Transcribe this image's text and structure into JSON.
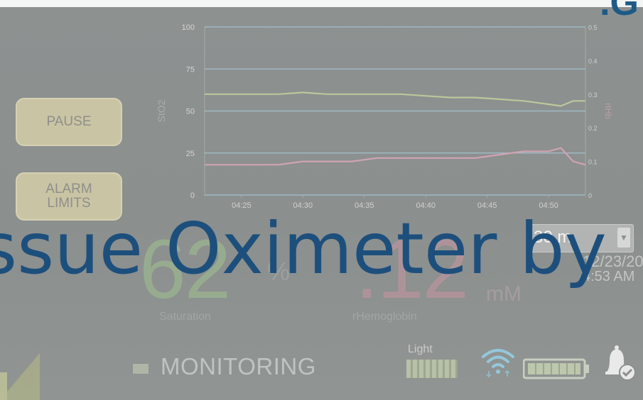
{
  "corner_fragment": ".G",
  "buttons": {
    "pause": "PAUSE",
    "alarm_line1": "ALARM",
    "alarm_line2": "LIMITS"
  },
  "chart_data": {
    "type": "line",
    "x_ticks": [
      "04:25",
      "04:30",
      "04:35",
      "04:40",
      "04:45",
      "04:50"
    ],
    "x_range": [
      "04:22",
      "04:53"
    ],
    "ylabel": "StO2",
    "ylim": [
      0,
      100
    ],
    "y_ticks": [
      0,
      25,
      50,
      75,
      100
    ],
    "y2label": "rtHb",
    "y2lim": [
      0,
      0.5
    ],
    "y2_ticks": [
      "0",
      "0.1",
      "0.2",
      "0.3",
      "0.4",
      "0.5"
    ],
    "grid": true,
    "series": [
      {
        "axis": "left",
        "color": "#bcc79a",
        "x": [
          "04:22",
          "04:24",
          "04:26",
          "04:28",
          "04:30",
          "04:32",
          "04:34",
          "04:36",
          "04:38",
          "04:40",
          "04:42",
          "04:44",
          "04:46",
          "04:48",
          "04:50",
          "04:51",
          "04:52",
          "04:53"
        ],
        "values": [
          60,
          60,
          60,
          60,
          61,
          60,
          60,
          60,
          60,
          59,
          58,
          58,
          57,
          56,
          54,
          53,
          56,
          56
        ]
      },
      {
        "axis": "right",
        "color": "#cfa3b3",
        "x": [
          "04:22",
          "04:24",
          "04:26",
          "04:28",
          "04:30",
          "04:32",
          "04:34",
          "04:36",
          "04:38",
          "04:40",
          "04:42",
          "04:44",
          "04:46",
          "04:48",
          "04:50",
          "04:51",
          "04:52",
          "04:53"
        ],
        "values": [
          0.09,
          0.09,
          0.09,
          0.09,
          0.1,
          0.1,
          0.1,
          0.11,
          0.11,
          0.11,
          0.11,
          0.11,
          0.12,
          0.13,
          0.13,
          0.14,
          0.1,
          0.09
        ]
      }
    ]
  },
  "range_select": {
    "value": "30 m"
  },
  "readings": {
    "saturation_value": "62",
    "saturation_unit": "%",
    "saturation_label": "Saturation",
    "hemoglobin_value": ".12",
    "hemoglobin_unit": "mM",
    "hemoglobin_label": "rHemoglobin"
  },
  "clock": {
    "date": "12/23/20",
    "time": "4:53 AM"
  },
  "status": {
    "text": "MONITORING"
  },
  "light": {
    "label": "Light",
    "level_percent": 100
  },
  "overlay": {
    "title": "ssue Oximeter by"
  },
  "colors": {
    "accent_title": "#1d4f7c",
    "saturation": "#97ac8f",
    "hemoglobin": "#ad9399"
  }
}
